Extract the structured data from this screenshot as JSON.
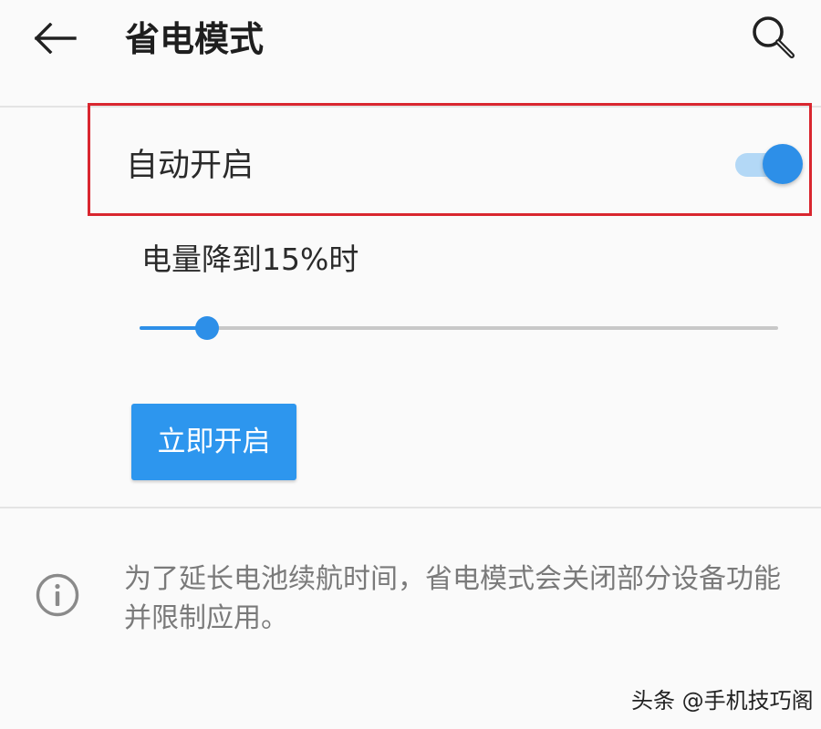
{
  "appbar": {
    "back_icon": "arrow-left-icon",
    "title": "省电模式",
    "search_icon": "search-icon"
  },
  "auto_enable": {
    "label": "自动开启",
    "enabled": true
  },
  "threshold": {
    "label": "电量降到15%时",
    "percent": 15
  },
  "actions": {
    "enable_now_label": "立即开启"
  },
  "info": {
    "icon": "info-icon",
    "text": "为了延长电池续航时间，省电模式会关闭部分设备功能并限制应用。"
  },
  "watermark": {
    "text": "头条 @手机技巧阁"
  },
  "colors": {
    "accent": "#2d8fe8",
    "button": "#2d96ee",
    "highlight_border": "#d9262f",
    "secondary_text": "#7a7a7a"
  }
}
